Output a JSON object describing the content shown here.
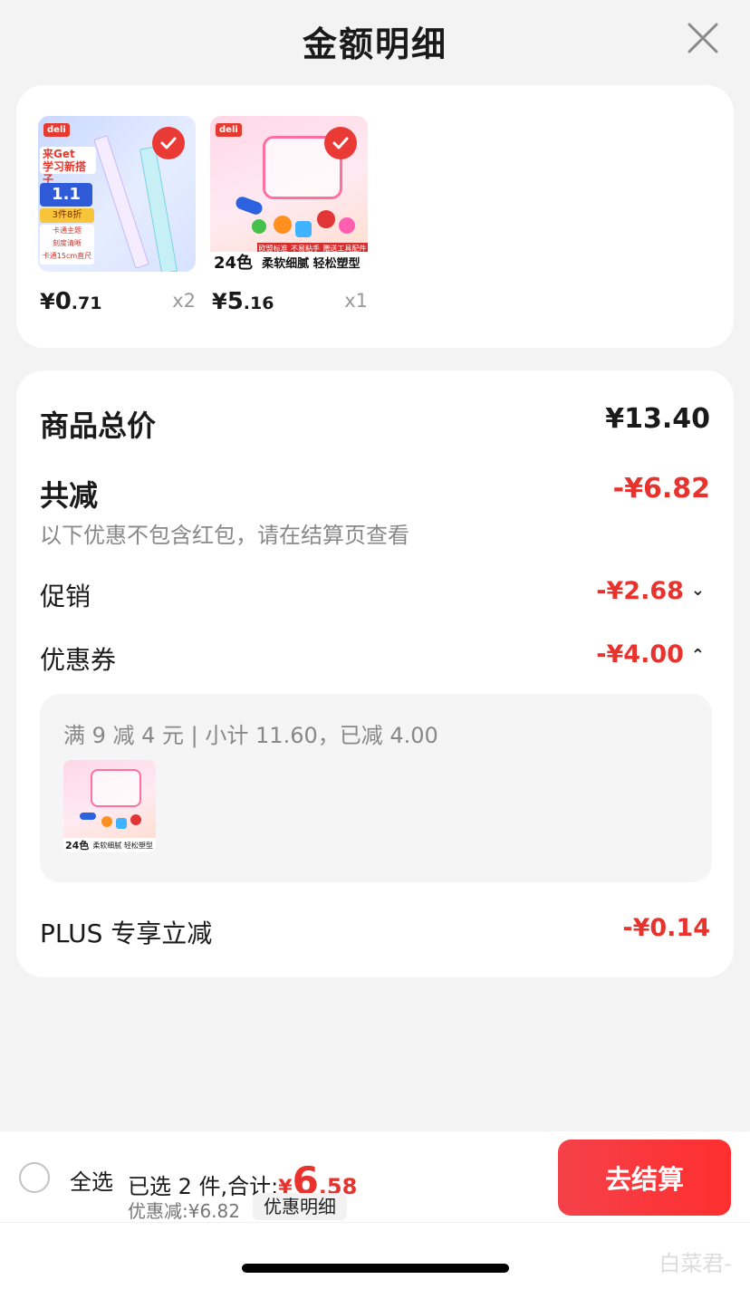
{
  "header": {
    "title": "金额明细",
    "close_icon": "close-icon"
  },
  "products": [
    {
      "name": "ruler",
      "price_symbol": "¥",
      "price_int": "0",
      "price_dec": ".71",
      "qty": "x2",
      "checked": true,
      "badge": "deli",
      "promo_line1": "来Get",
      "promo_line2": "学习新搭子",
      "promo_big": "1.1",
      "tag": "3件8折",
      "feat1": "卡通主题",
      "feat2": "刻度清晰",
      "feat3": "卡通15cm直尺"
    },
    {
      "name": "clay",
      "price_symbol": "¥",
      "price_int": "5",
      "price_dec": ".16",
      "qty": "x1",
      "checked": true,
      "badge": "deli",
      "colors": "24色",
      "slogan": "柔软细腻 轻松塑型",
      "f1": "欧盟标准",
      "f2": "不易粘手",
      "f3": "赠送工具配件"
    }
  ],
  "summary": {
    "total_label": "商品总价",
    "total_value": "¥13.40",
    "reduce_label": "共减",
    "reduce_value": "-¥6.82",
    "reduce_note": "以下优惠不包含红包，请在结算页查看",
    "promo_label": "促销",
    "promo_value": "-¥2.68",
    "coupon_label": "优惠券",
    "coupon_value": "-¥4.00",
    "coupon_desc": "满 9 减 4 元 | 小计 11.60，已减 4.00",
    "plus_label": "PLUS 专享立减",
    "plus_value": "-¥0.14"
  },
  "bottom": {
    "select_all": "全选",
    "selected_text": "已选 2 件,合计:",
    "total_symbol": "¥",
    "total_int": "6",
    "total_dec": ".58",
    "discount_text": "优惠减:¥6.82",
    "detail_button": "优惠明细",
    "checkout_button": "去结算",
    "watermark": "白菜君-"
  },
  "colors": {
    "accent_red": "#e8322d",
    "background": "#f3f3f3"
  }
}
